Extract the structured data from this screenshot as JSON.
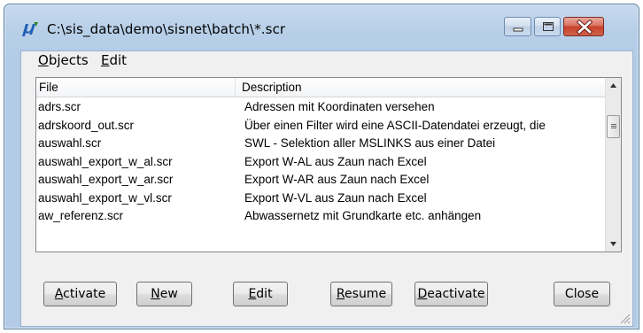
{
  "window": {
    "title": "C:\\sis_data\\demo\\sisnet\\batch\\*.scr",
    "app_icon": "app-logo-icon"
  },
  "menu": [
    {
      "label": "Objects",
      "mnemonic": "O",
      "rest": "bjects"
    },
    {
      "label": "Edit",
      "mnemonic": "E",
      "rest": "dit"
    }
  ],
  "list": {
    "columns": [
      "File",
      "Description"
    ],
    "rows": [
      {
        "file": "adrs.scr",
        "description": "Adressen mit Koordinaten versehen"
      },
      {
        "file": "adrskoord_out.scr",
        "description": "Über einen Filter wird eine ASCII-Datendatei erzeugt, die"
      },
      {
        "file": "auswahl.scr",
        "description": "SWL - Selektion aller MSLINKS aus einer Datei"
      },
      {
        "file": "auswahl_export_w_al.scr",
        "description": "Export W-AL aus Zaun nach Excel"
      },
      {
        "file": "auswahl_export_w_ar.scr",
        "description": "Export W-AR aus Zaun nach Excel"
      },
      {
        "file": "auswahl_export_w_vl.scr",
        "description": "Export W-VL aus Zaun nach Excel"
      },
      {
        "file": "aw_referenz.scr",
        "description": "Abwassernetz mit Grundkarte etc. anhängen"
      }
    ]
  },
  "buttons": {
    "activate": {
      "mnemonic": "A",
      "rest": "ctivate"
    },
    "new": {
      "mnemonic": "N",
      "rest": "ew"
    },
    "edit": {
      "mnemonic": "E",
      "rest": "dit"
    },
    "resume": {
      "mnemonic": "R",
      "rest": "esume"
    },
    "deactivate": {
      "mnemonic": "D",
      "rest": "eactivate"
    },
    "close": {
      "label": "Close"
    }
  },
  "colors": {
    "titlebar": "#b8cfe8",
    "close_button": "#c8412c",
    "client_bg": "#f0f0f0"
  }
}
